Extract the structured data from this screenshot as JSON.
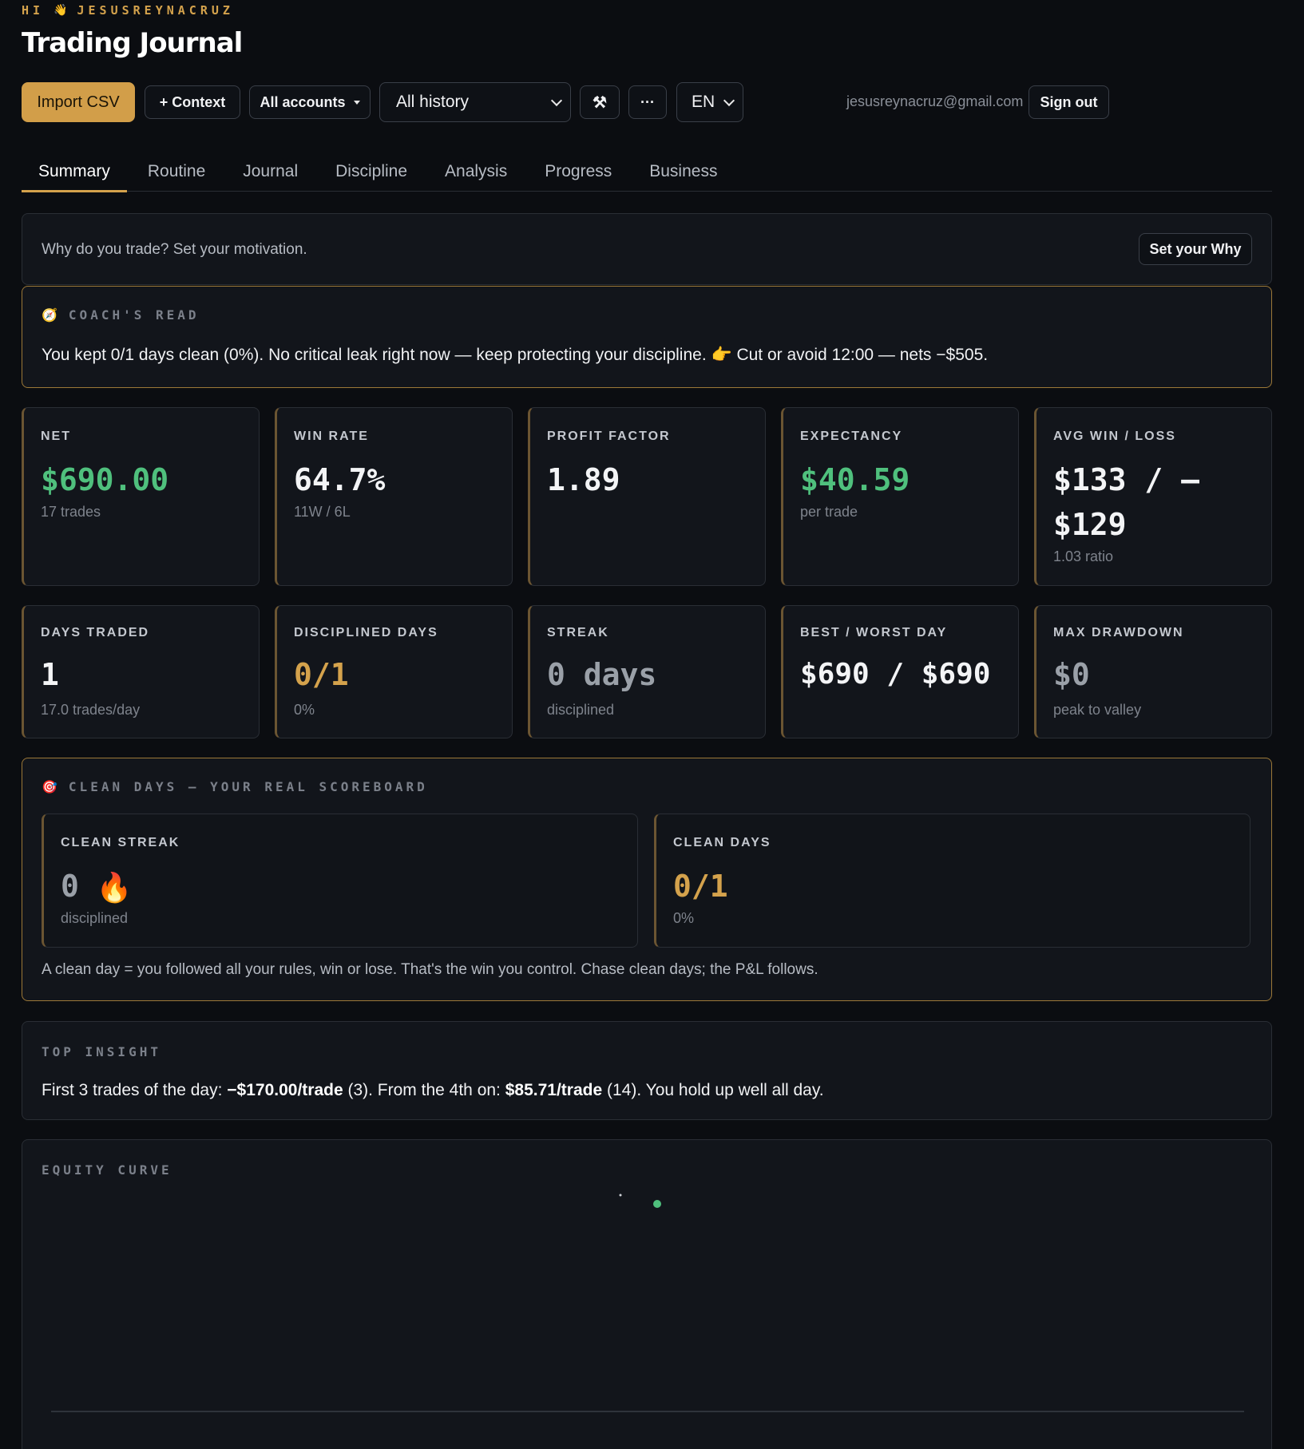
{
  "header": {
    "greeting_prefix": "HI",
    "greeting_emoji": "👋",
    "username": "JESUSREYNACRUZ",
    "title": "Trading Journal"
  },
  "toolbar": {
    "import_label": "Import CSV",
    "context_label": "+ Context",
    "accounts_label": "All accounts",
    "history_label": "All history",
    "tools_icon": "⚒",
    "more_label": "···",
    "lang_label": "EN",
    "email": "jesusreynacruz@gmail.com",
    "signout_label": "Sign out"
  },
  "tabs": [
    "Summary",
    "Routine",
    "Journal",
    "Discipline",
    "Analysis",
    "Progress",
    "Business"
  ],
  "motivation": {
    "text": "Why do you trade? Set your motivation.",
    "button": "Set your Why"
  },
  "coach": {
    "icon": "🧭",
    "label": "COACH'S READ",
    "text": "You kept 0/1 days clean (0%). No critical leak right now — keep protecting your discipline. 👉 Cut or avoid 12:00 — nets −$505."
  },
  "stats_row1": [
    {
      "label": "NET",
      "value": "$690.00",
      "sub": "17 trades",
      "color": "#4fc07d"
    },
    {
      "label": "WIN RATE",
      "value": "64.7%",
      "sub": "11W / 6L",
      "color": "#f3f4f6"
    },
    {
      "label": "PROFIT FACTOR",
      "value": "1.89",
      "sub": "",
      "color": "#f3f4f6"
    },
    {
      "label": "EXPECTANCY",
      "value": "$40.59",
      "sub": "per trade",
      "color": "#4fc07d"
    },
    {
      "label": "AVG WIN / LOSS",
      "value_line1": "$133 / –",
      "value_line2": "$129",
      "sub": "1.03 ratio",
      "color": "#f3f4f6"
    }
  ],
  "stats_row2": [
    {
      "label": "DAYS TRADED",
      "value": "1",
      "sub": "17.0 trades/day",
      "color": "#f3f4f6"
    },
    {
      "label": "DISCIPLINED DAYS",
      "value": "0/1",
      "sub": "0%",
      "color": "#d4a24c"
    },
    {
      "label": "STREAK",
      "value": "0 days",
      "sub": "disciplined",
      "color": "#9aa0a8"
    },
    {
      "label": "BEST / WORST DAY",
      "value": "$690 / $690",
      "sub": "",
      "color": "#f3f4f6"
    },
    {
      "label": "MAX DRAWDOWN",
      "value": "$0",
      "sub": "peak to valley",
      "color": "#9aa0a8"
    }
  ],
  "clean_days": {
    "icon": "🎯",
    "label": "CLEAN DAYS — YOUR REAL SCOREBOARD",
    "streak_label": "CLEAN STREAK",
    "streak_value": "0",
    "streak_emoji": "🔥",
    "streak_sub": "disciplined",
    "days_label": "CLEAN DAYS",
    "days_value": "0/1",
    "days_sub": "0%",
    "note": "A clean day = you followed all your rules, win or lose. That's the win you control. Chase clean days; the P&L follows."
  },
  "insight": {
    "label": "TOP INSIGHT",
    "part1": "First 3 trades of the day: ",
    "bold1": "−$170.00/trade",
    "part2": " (3). From the 4th on: ",
    "bold2": "$85.71/trade",
    "part3": " (14). You hold up well all day."
  },
  "equity": {
    "label": "EQUITY CURVE"
  },
  "colors": {
    "accent": "#d4a24c",
    "positive": "#4fc07d",
    "background": "#0b0d11",
    "card": "#12151b"
  }
}
